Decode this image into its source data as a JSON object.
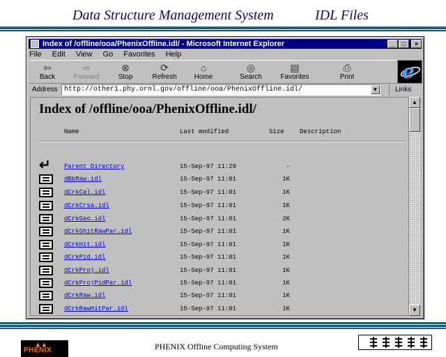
{
  "slide": {
    "title_left": "Data Structure Management System",
    "title_right": "IDL Files",
    "footer": "PHENIX Offline Computing System",
    "logo_text": "PHENIX"
  },
  "window": {
    "title": "Index of /offline/ooa/PhenixOffline.idl/ - Microsoft Internet Explorer",
    "controls": [
      "_",
      "□",
      "×"
    ],
    "menu": [
      "File",
      "Edit",
      "View",
      "Go",
      "Favorites",
      "Help"
    ],
    "toolbar": [
      {
        "label": "Back",
        "icon": "back-arrow-icon",
        "glyph": "⇦"
      },
      {
        "label": "Forward",
        "icon": "forward-arrow-icon",
        "glyph": "⇨"
      },
      {
        "label": "Stop",
        "icon": "stop-icon",
        "glyph": "⊗"
      },
      {
        "label": "Refresh",
        "icon": "refresh-icon",
        "glyph": "⟳"
      },
      {
        "label": "Home",
        "icon": "home-icon",
        "glyph": "⌂"
      },
      {
        "label": "Search",
        "icon": "search-icon",
        "glyph": "◎"
      },
      {
        "label": "Favorites",
        "icon": "favorites-icon",
        "glyph": "▤"
      },
      {
        "label": "Print",
        "icon": "print-icon",
        "glyph": "⎙"
      }
    ],
    "address_label": "Address",
    "address_value": "http://other1.phy.ornl.gov/offline/ooa/PhenixOffline.idl/",
    "links_label": "Links"
  },
  "listing": {
    "heading": "Index of /offline/ooa/PhenixOffline.idl/",
    "columns": {
      "name": "Name",
      "modified": "Last modified",
      "size": "Size",
      "description": "Description"
    },
    "parent": {
      "name": "Parent Directory",
      "modified": "15-Sep-97 11:29",
      "size": "-"
    },
    "files": [
      {
        "name": "dBbRaw.idl",
        "modified": "15-Sep-97 11:01",
        "size": "1K"
      },
      {
        "name": "dCrkCal.idl",
        "modified": "15-Sep-97 11:01",
        "size": "1K"
      },
      {
        "name": "dCrkCrsa.idl",
        "modified": "15-Sep-97 11:01",
        "size": "1K"
      },
      {
        "name": "dCrkGeo.idl",
        "modified": "15-Sep-97 11:01",
        "size": "2K"
      },
      {
        "name": "dCrkGhitRawPar.idl",
        "modified": "15-Sep-97 11:01",
        "size": "1K"
      },
      {
        "name": "dCrkHit.idl",
        "modified": "15-Sep-97 11:01",
        "size": "1K"
      },
      {
        "name": "dCrkPid.idl",
        "modified": "15-Sep-97 11:01",
        "size": "1K"
      },
      {
        "name": "dCrkProj.idl",
        "modified": "15-Sep-97 11:01",
        "size": "1K"
      },
      {
        "name": "dCrkProjPidPar.idl",
        "modified": "15-Sep-97 11:01",
        "size": "1K"
      },
      {
        "name": "dCrkRaw.idl",
        "modified": "15-Sep-97 11:01",
        "size": "1K"
      },
      {
        "name": "dCrkRawHitPar.idl",
        "modified": "15-Sep-97 11:01",
        "size": "1K"
      }
    ]
  }
}
